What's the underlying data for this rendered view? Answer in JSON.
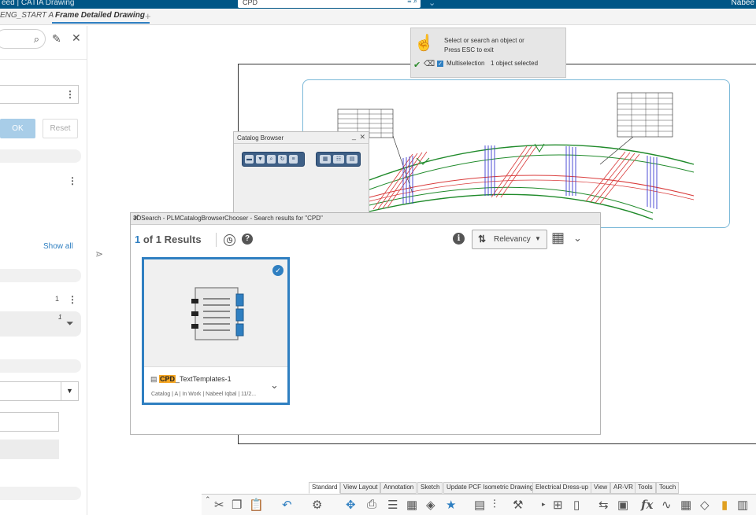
{
  "topbar": {
    "app_title": "eed | CATIA Drawing",
    "search_value": "CPD",
    "user_name": "Nabee"
  },
  "tabs": [
    {
      "label": "ENG_START A"
    },
    {
      "label": "Frame Detailed Drawing"
    }
  ],
  "left_panel": {
    "ok_label": "OK",
    "reset_label": "Reset",
    "show_all_label": "Show all",
    "count_a": "1",
    "count_b": "1"
  },
  "select_tooltip": {
    "line1": "Select or search an object or",
    "line2": "Press ESC to exit",
    "multi_label": "Multiselection",
    "status": "1 object selected"
  },
  "catalog_browser": {
    "title": "Catalog Browser"
  },
  "search3d": {
    "title": "3DSearch - PLMCatalogBrowserChooser - Search results for \"CPD\"",
    "current": "1",
    "of": "of",
    "total": "1",
    "results_label": "Results",
    "sort_label": "Relevancy",
    "result": {
      "name_highlight": "CPD",
      "name_rest": "_TextTemplates-1",
      "meta": "Catalog | A | In Work | Nabeel Iqbal | 11/2..."
    }
  },
  "bottom_tabs": [
    "Standard",
    "View Layout",
    "Annotation",
    "Sketch",
    "Update PCF Isometric Drawing",
    "Electrical Dress-up",
    "View",
    "AR-VR",
    "Tools",
    "Touch"
  ],
  "bottom_tab_active": "Standard",
  "colors": {
    "topbar": "#005686",
    "accent": "#2f7fc1",
    "highlight": "#f5a623",
    "drawing_red": "#d93a3a",
    "drawing_blue": "#3a3ad0",
    "drawing_green": "#1f8a2a"
  }
}
